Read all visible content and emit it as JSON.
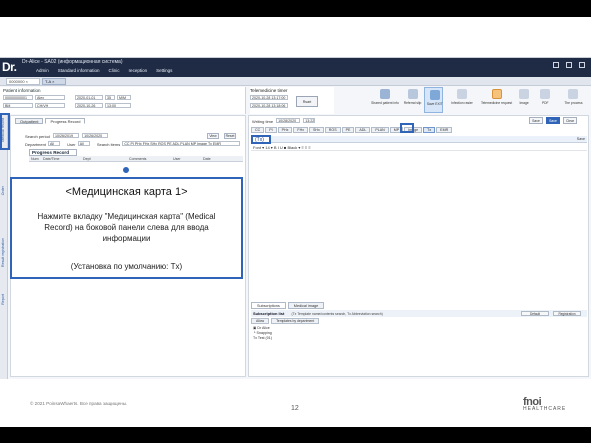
{
  "app": {
    "logo": "Dr.",
    "title": "Dr-Alice - SA02  (информационная система)",
    "menu": [
      "Admin",
      "Standard information",
      "Clinic",
      "reception",
      "Settings"
    ]
  },
  "tabs": {
    "patient_tab": "0000000 ×",
    "record_tab": "T-A ×"
  },
  "patient": {
    "label": "Patient information",
    "fields": [
      "00000000001",
      "Alex",
      "2020-01-01",
      "35",
      "M/M",
      "BM",
      "CH/VH",
      "2020-10-26",
      "13:00"
    ]
  },
  "telemedicine": {
    "label": "Telemedicine timer",
    "start": "2020-10-28 13:17:00",
    "end": "2020-10-28 13:18:06",
    "record_button": "Rsart"
  },
  "toolbar": {
    "items": [
      {
        "label": "Shared patient info",
        "color": "#9bb3d4"
      },
      {
        "label": "Referral slip",
        "color": "#b8c7dc"
      },
      {
        "label": "Save EXIT",
        "color": "#7ea8d8"
      },
      {
        "label": "Infection rasier",
        "color": "#c9d3e2"
      },
      {
        "label": "Telemedicine request",
        "color": "#f7c27a"
      },
      {
        "label": "Image",
        "color": "#c9d3e2"
      },
      {
        "label": "PDF",
        "color": "#c9d3e2"
      },
      {
        "label": "The process",
        "color": "#c9d3e2"
      }
    ]
  },
  "leftnav": {
    "items": [
      "Medical record",
      "Order",
      "Result registration",
      "Report"
    ]
  },
  "progress": {
    "tabs": [
      "Outpatient",
      "Progress Record"
    ],
    "search_period_label": "Search period",
    "search_from": "10/26/2019",
    "search_to": "10/26/2020",
    "department_label": "Department",
    "department_value": "All",
    "user_label": "User",
    "user_value": "All",
    "search_items_label": "Search items",
    "search_items_value": "CC PI PHx FHx SHx ROS PE ADL PLAN MP Image Tx EMR",
    "view_button": "View",
    "reset_button": "Reset",
    "title": "Progress Record",
    "columns": [
      "Num",
      "Date/Time",
      "Dept",
      "Comments",
      "User",
      "Date"
    ]
  },
  "callout": {
    "title": "<Медицинская карта 1>",
    "body": "Нажмите вкладку \"Медицинская карта\" (Medical Record) на боковой панели слева для ввода информации",
    "default": "(Установка по умолчанию: Tx)"
  },
  "editor": {
    "writing_time_label": "Writing time",
    "writing_time_value": "10/28/2020",
    "writing_time_clock": "13:22",
    "tabs": [
      "CC",
      "PI",
      "PHx",
      "FHx",
      "SHx",
      "ROS",
      "PE",
      "ADL",
      "PLAN",
      "MP",
      "Image",
      "Tx",
      "EMR"
    ],
    "selected_tab": "Tx",
    "buttons": [
      "Save",
      "Save",
      "Clear"
    ],
    "section_label": "(Tx)",
    "save_link": "Save",
    "format_bar": "Font  ▾  14 ▾   B  I  U   ■  Black ▾   ≡  ≡  ≡",
    "bottom_tabs": [
      "Subscriptions",
      "Medical image"
    ],
    "subscription_label": "Subscription list",
    "subscription_conditions": "(Tx Template name/contents search, Tx Abbreviation search)",
    "subscription_buttons": [
      "Default",
      "Registration"
    ],
    "sub_tabs": [
      "Allow",
      "Templates by department"
    ],
    "tree": [
      "▣ Dr Alice",
      "  └ Snapping",
      "       Tx Test (01)"
    ]
  },
  "footer": {
    "copyright": "© 2021 PoinsaWhaerts. Все права защищены.",
    "page": "12",
    "brand_top": "fnoi",
    "brand_bottom": "HEALTHCARE"
  }
}
